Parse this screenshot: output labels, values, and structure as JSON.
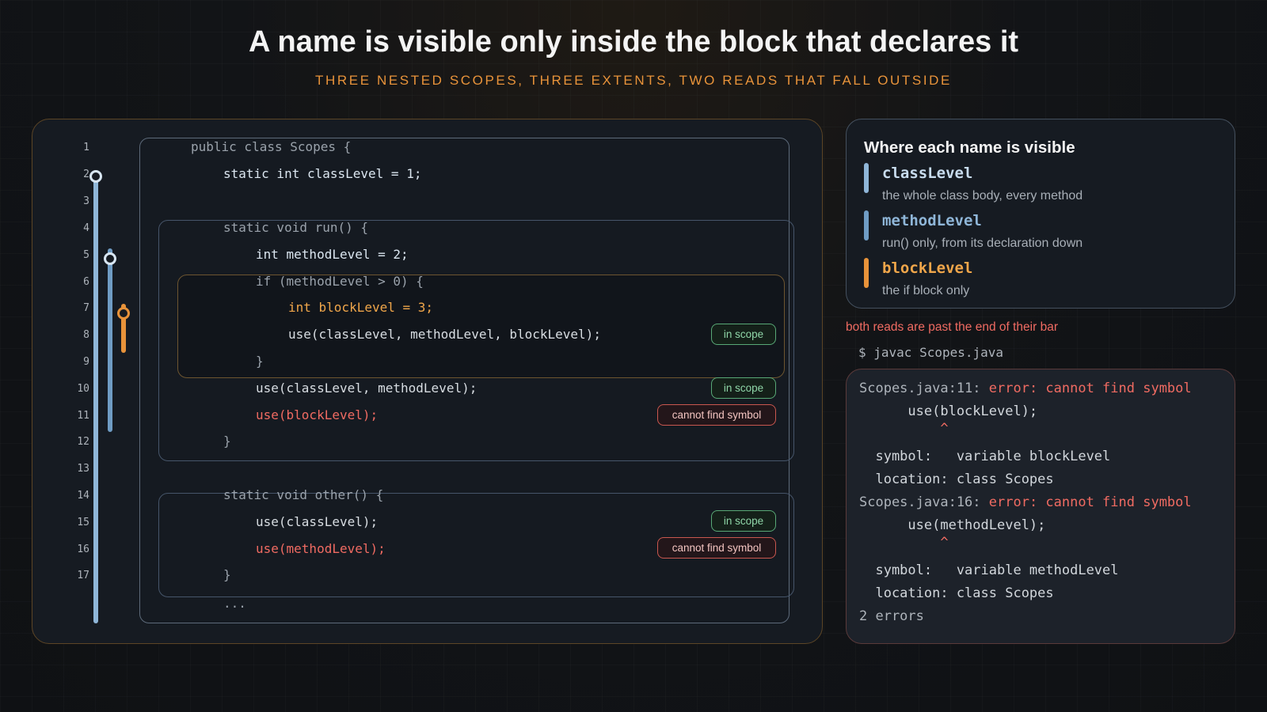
{
  "header": {
    "title": "A name is visible only inside the block that declares it",
    "subtitle": "THREE NESTED SCOPES, THREE EXTENTS, TWO READS THAT FALL OUTSIDE"
  },
  "colors": {
    "class_scope": "#8fb6d8",
    "method_scope": "#6f9cc4",
    "block_scope": "#e8933a",
    "error": "#f06b62",
    "ok": "#58a876"
  },
  "code": {
    "line_numbers": [
      "1",
      "2",
      "3",
      "4",
      "5",
      "6",
      "7",
      "8",
      "9",
      "10",
      "11",
      "12",
      "13",
      "14",
      "15",
      "16",
      "17"
    ],
    "lines": {
      "l1": "public class Scopes {",
      "l2": "static int classLevel = 1;",
      "l4": "static void run() {",
      "l5": "int methodLevel = 2;",
      "l6": "if (methodLevel > 0) {",
      "l7": "int blockLevel = 3;",
      "l8": "use(classLevel, methodLevel, blockLevel);",
      "l9": "}",
      "l10": "use(classLevel, methodLevel);",
      "l11": "use(blockLevel);",
      "l12": "}",
      "l14": "static void other() {",
      "l15": "use(classLevel);",
      "l16": "use(methodLevel);",
      "l17": "}",
      "ellipsis": "..."
    },
    "badges": {
      "in_scope": "in scope",
      "error": "cannot find symbol"
    }
  },
  "legend": {
    "title": "Where each name is visible",
    "items": [
      {
        "name": "classLevel",
        "desc": "the whole class body, every method",
        "color": "#8fb6d8"
      },
      {
        "name": "methodLevel",
        "desc": "run() only, from its declaration down",
        "color": "#6f9cc4"
      },
      {
        "name": "blockLevel",
        "desc": "the if block only",
        "color": "#e8933a"
      }
    ]
  },
  "note": "both reads are past the end of their bar",
  "command": "$ javac Scopes.java",
  "terminal": {
    "e1_loc": "Scopes.java:11: ",
    "e1_msg": "error: cannot find symbol",
    "e1_code": "      use(blockLevel);",
    "e1_caret": "          ^",
    "e1_symbol": "  symbol:   variable blockLevel",
    "e1_location": "  location: class Scopes",
    "e2_loc": "Scopes.java:16: ",
    "e2_msg": "error: cannot find symbol",
    "e2_code": "      use(methodLevel);",
    "e2_caret": "          ^",
    "e2_symbol": "  symbol:   variable methodLevel",
    "e2_location": "  location: class Scopes",
    "summary": "2 errors"
  }
}
